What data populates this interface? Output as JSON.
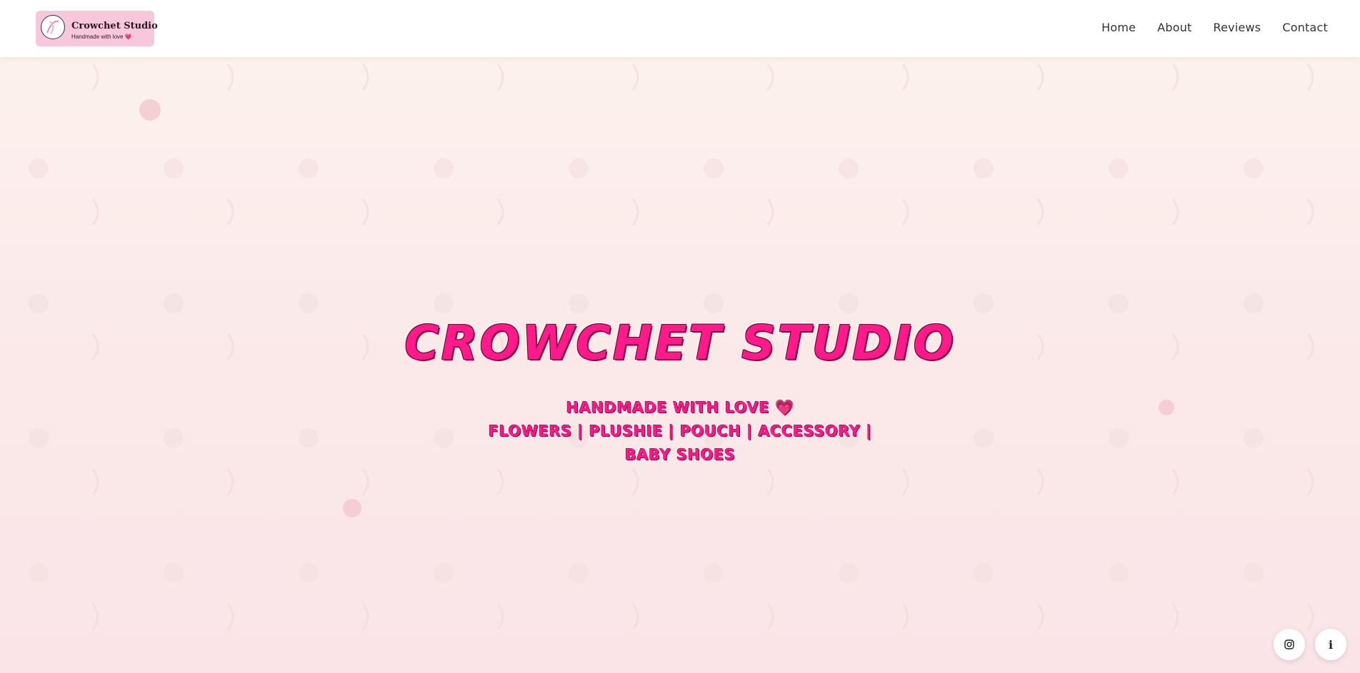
{
  "header": {
    "logo": {
      "title": "Crowchet Studio",
      "subtitle": "Handmade with love",
      "heart": "💗"
    },
    "nav": [
      {
        "label": "Home"
      },
      {
        "label": "About"
      },
      {
        "label": "Reviews"
      },
      {
        "label": "Contact"
      }
    ]
  },
  "hero": {
    "title": "CROWCHET STUDIO",
    "line1": "HANDMADE WITH LOVE 💗",
    "line2": "FLOWERS | PLUSHIE | POUCH | ACCESSORY |",
    "line3": "BABY SHOES"
  },
  "floating_buttons": {
    "instagram_icon": "instagram-icon",
    "info_label": "i"
  },
  "colors": {
    "accent": "#ff1a8c",
    "logo_bg": "#f7c8dc",
    "background": "#fbeaea"
  }
}
